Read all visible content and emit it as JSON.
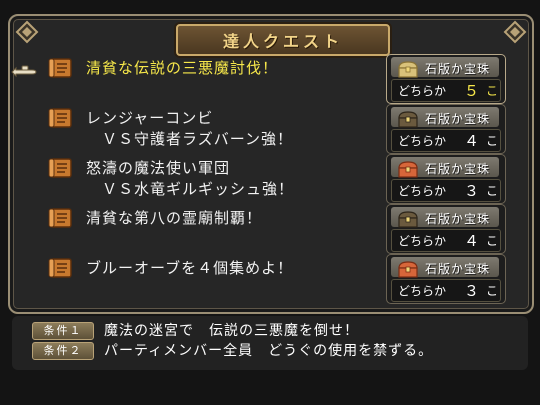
{
  "window": {
    "title": "達人クエスト"
  },
  "quests": [
    {
      "name": "清貧な伝説の三悪魔討伐！",
      "reward_type": "石版か宝珠",
      "either_label": "どちらか",
      "count": "５",
      "unit": "こ",
      "chest": "silver",
      "selected": true
    },
    {
      "name": "レンジャーコンビ\n　ＶＳ守護者ラズバーン強！",
      "reward_type": "石版か宝珠",
      "either_label": "どちらか",
      "count": "４",
      "unit": "こ",
      "chest": "dark",
      "selected": false
    },
    {
      "name": "怒濤の魔法使い軍団\n　ＶＳ水竜ギルギッシュ強！",
      "reward_type": "石版か宝珠",
      "either_label": "どちらか",
      "count": "３",
      "unit": "こ",
      "chest": "red",
      "selected": false
    },
    {
      "name": "清貧な第八の霊廟制覇！",
      "reward_type": "石版か宝珠",
      "either_label": "どちらか",
      "count": "４",
      "unit": "こ",
      "chest": "dark",
      "selected": false
    },
    {
      "name": "ブルーオーブを４個集めよ！",
      "reward_type": "石版か宝珠",
      "either_label": "どちらか",
      "count": "３",
      "unit": "こ",
      "chest": "red",
      "selected": false
    }
  ],
  "conditions": [
    {
      "label": "条件１",
      "text": "魔法の迷宮で　伝説の三悪魔を倒せ！"
    },
    {
      "label": "条件２",
      "text": "パーティメンバー全員　どうぐの使用を禁ずる。"
    }
  ],
  "colors": {
    "selected_text": "#f7e84a",
    "frame_border": "#9a8e74",
    "title_text": "#f2d489"
  }
}
